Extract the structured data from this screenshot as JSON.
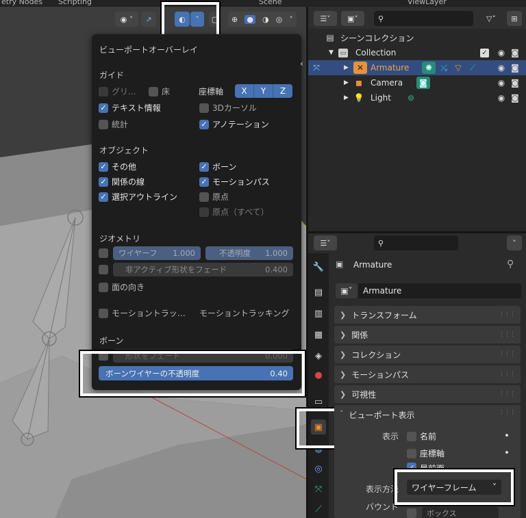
{
  "topbar": {
    "workspace_left": "etry Nodes",
    "workspace_scripting": "Scripting",
    "scene": "Scene",
    "view_layer": "ViewLayer"
  },
  "overlay_popup": {
    "title": "ビューポートオーバーレイ",
    "guides": {
      "section": "ガイド",
      "grid": "グリ…",
      "floor": "床",
      "axes_label": "座標軸",
      "axis_x": "X",
      "axis_y": "Y",
      "axis_z": "Z",
      "text_info": "テキスト情報",
      "cursor_3d": "3Dカーソル",
      "statistics": "統計",
      "annotations": "アノテーション"
    },
    "objects": {
      "section": "オブジェクト",
      "extras": "その他",
      "bones": "ボーン",
      "relationship_lines": "関係の線",
      "motion_paths": "モーションパス",
      "outline_selected": "選択アウトライン",
      "origins": "原点",
      "origins_all": "原点（すべて）"
    },
    "geometry": {
      "section": "ジオメトリ",
      "wireframe_label": "ワイヤーフ",
      "wireframe_value": "1.000",
      "opacity_label": "不透明度",
      "opacity_value": "1.000",
      "fade_inactive_label": "非アクティブ形状をフェード",
      "fade_inactive_value": "0.400",
      "face_orientation": "面の向き"
    },
    "motion_tracking": {
      "toggle": "モーショントラッ…",
      "label": "モーショントラッキング"
    },
    "bones": {
      "section": "ボーン",
      "fade_geometry_label": "形状をフェード",
      "fade_geometry_value": "0.000",
      "wire_opacity_label": "ボーンワイヤーの不透明度",
      "wire_opacity_value": "0.40"
    }
  },
  "outliner": {
    "scene_collection": "シーンコレクション",
    "rows": [
      {
        "label": "Collection"
      },
      {
        "label": "Armature"
      },
      {
        "label": "Camera"
      },
      {
        "label": "Light"
      }
    ]
  },
  "properties": {
    "object_name": "Armature",
    "object_field": "Armature",
    "panels": [
      "トランスフォーム",
      "関係",
      "コレクション",
      "モーションパス",
      "可視性"
    ],
    "viewport_display": {
      "title": "ビューポート表示",
      "show_label": "表示",
      "name": "名前",
      "axes": "座標軸",
      "in_front": "最前面",
      "display_as_label": "表示方法",
      "display_as_value": "ワイヤーフレーム",
      "bounds_label": "バウンド",
      "bounds_value": "ボックス"
    }
  },
  "colors": {
    "accent": "#4772b3",
    "selected_row": "#334d80",
    "armature_orange": "#e5923e",
    "icon_green": "#2ebd8b"
  }
}
